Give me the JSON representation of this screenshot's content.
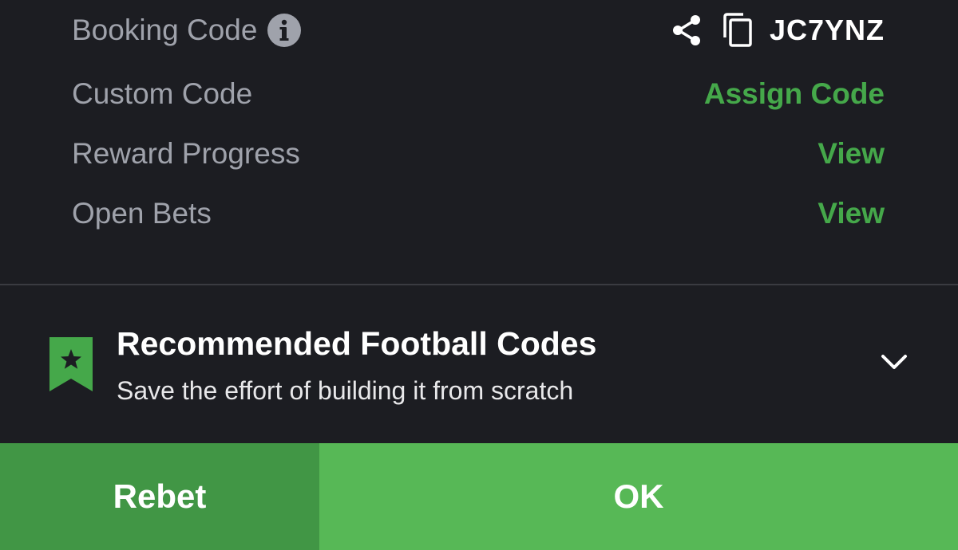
{
  "rows": {
    "booking_code": {
      "label": "Booking Code",
      "code": "JC7YNZ"
    },
    "custom_code": {
      "label": "Custom Code",
      "action": "Assign Code"
    },
    "reward_progress": {
      "label": "Reward Progress",
      "action": "View"
    },
    "open_bets": {
      "label": "Open Bets",
      "action": "View"
    }
  },
  "recommended": {
    "title": "Recommended Football Codes",
    "subtitle": "Save the effort of building it from scratch"
  },
  "buttons": {
    "rebet": "Rebet",
    "ok": "OK"
  },
  "icons": {
    "info": "info-icon",
    "share": "share-icon",
    "copy": "copy-icon",
    "bookmark": "bookmark-star-icon",
    "chevron": "chevron-down-icon"
  },
  "colors": {
    "background": "#1c1d22",
    "label": "#9fa2ab",
    "accent_green": "#45a84a",
    "rebet_button": "#419645",
    "ok_button": "#57b856",
    "divider": "#3a3b41"
  }
}
